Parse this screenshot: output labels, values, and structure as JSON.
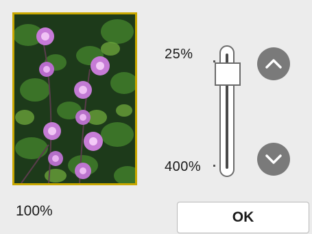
{
  "zoom": {
    "min_label": "25%",
    "max_label": "400%",
    "current_label": "100%",
    "slider_fraction_from_top": 0.16
  },
  "buttons": {
    "ok_label": "OK",
    "up_icon": "chevron-up-icon",
    "down_icon": "chevron-down-icon"
  },
  "preview": {
    "content": "water-lilies-photo",
    "frame_color": "#c9a800"
  },
  "colors": {
    "button_gray": "#7a7a7a",
    "background": "#ececec"
  }
}
